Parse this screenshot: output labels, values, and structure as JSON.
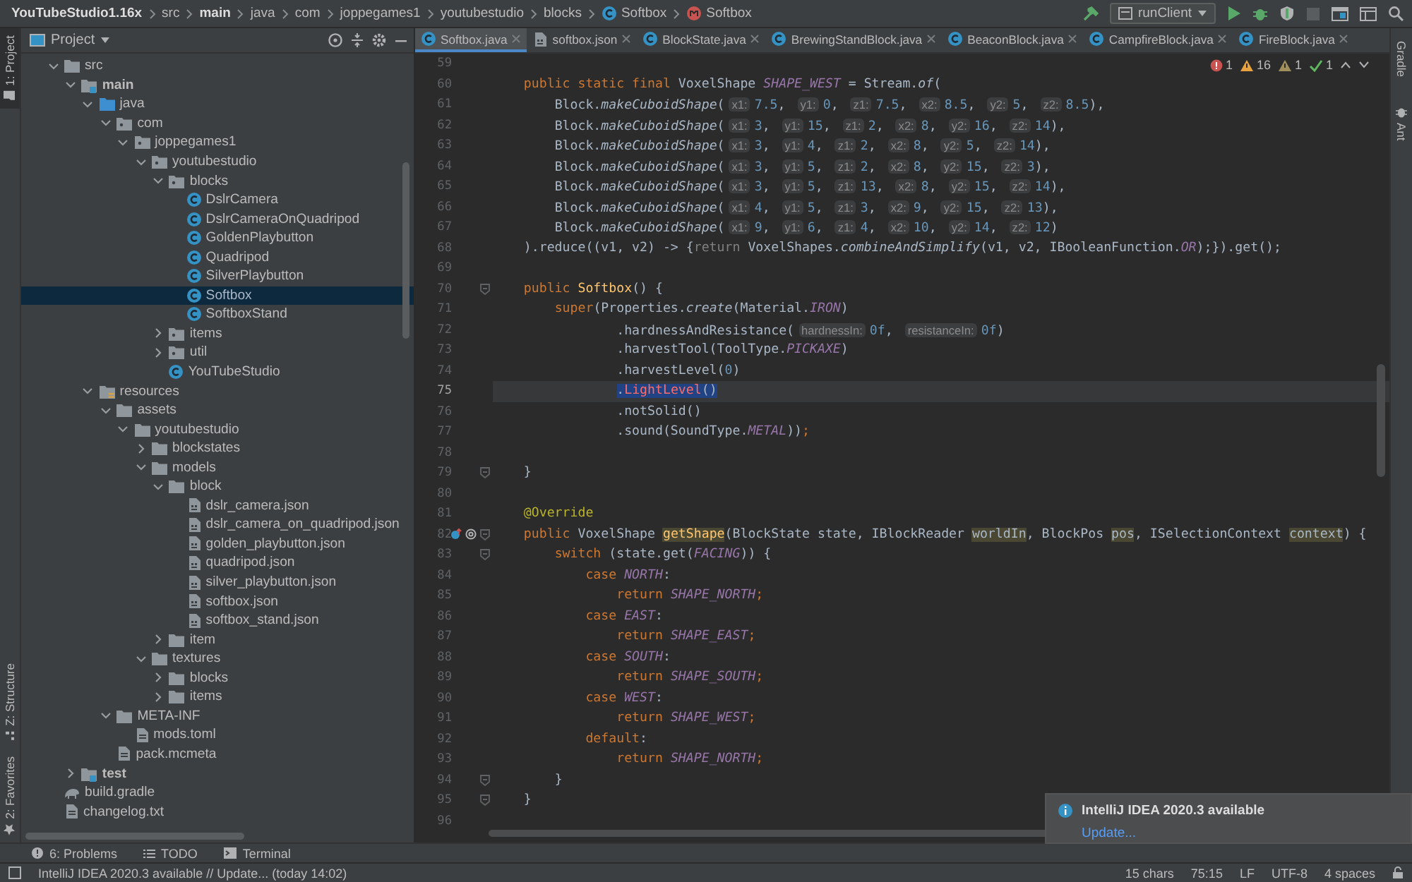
{
  "breadcrumbs": [
    {
      "label": "YouTubeStudio1.16x",
      "kind": "project"
    },
    {
      "label": "src",
      "kind": "folder"
    },
    {
      "label": "main",
      "kind": "module"
    },
    {
      "label": "java",
      "kind": "folder"
    },
    {
      "label": "com",
      "kind": "folder"
    },
    {
      "label": "joppegames1",
      "kind": "folder"
    },
    {
      "label": "youtubestudio",
      "kind": "folder"
    },
    {
      "label": "blocks",
      "kind": "folder"
    },
    {
      "label": "Softbox",
      "kind": "class"
    },
    {
      "label": "Softbox",
      "kind": "method"
    }
  ],
  "toolbar": {
    "run_config": "runClient"
  },
  "left_stripe": [
    {
      "label": "1: Project",
      "kind": "project",
      "selected": true
    },
    {
      "label": "Z: Structure",
      "kind": "structure",
      "selected": false
    },
    {
      "label": "2: Favorites",
      "kind": "favorites",
      "selected": false
    }
  ],
  "right_stripe": [
    {
      "label": "Gradle",
      "kind": "gradle"
    },
    {
      "label": "Ant",
      "kind": "ant"
    }
  ],
  "tool_window": {
    "title": "Project"
  },
  "tree": [
    {
      "label": "src",
      "kind": "folder",
      "expanded": true,
      "selected": false,
      "children": [
        {
          "label": "main",
          "kind": "module",
          "expanded": true,
          "selected": false,
          "children": [
            {
              "label": "java",
              "kind": "source",
              "expanded": true,
              "selected": false,
              "children": [
                {
                  "label": "com",
                  "kind": "package",
                  "expanded": true,
                  "selected": false,
                  "children": [
                    {
                      "label": "joppegames1",
                      "kind": "package",
                      "expanded": true,
                      "selected": false,
                      "children": [
                        {
                          "label": "youtubestudio",
                          "kind": "package",
                          "expanded": true,
                          "selected": false,
                          "children": [
                            {
                              "label": "blocks",
                              "kind": "package",
                              "expanded": true,
                              "selected": false,
                              "children": [
                                {
                                  "label": "DslrCamera",
                                  "kind": "class",
                                  "selected": false
                                },
                                {
                                  "label": "DslrCameraOnQuadripod",
                                  "kind": "class",
                                  "selected": false
                                },
                                {
                                  "label": "GoldenPlaybutton",
                                  "kind": "class",
                                  "selected": false
                                },
                                {
                                  "label": "Quadripod",
                                  "kind": "class",
                                  "selected": false
                                },
                                {
                                  "label": "SilverPlaybutton",
                                  "kind": "class",
                                  "selected": false
                                },
                                {
                                  "label": "Softbox",
                                  "kind": "class",
                                  "selected": true
                                },
                                {
                                  "label": "SoftboxStand",
                                  "kind": "class",
                                  "selected": false
                                }
                              ]
                            },
                            {
                              "label": "items",
                              "kind": "package",
                              "expanded": false,
                              "selected": false
                            },
                            {
                              "label": "util",
                              "kind": "package",
                              "expanded": false,
                              "selected": false
                            },
                            {
                              "label": "YouTubeStudio",
                              "kind": "class",
                              "selected": false
                            }
                          ]
                        }
                      ]
                    }
                  ]
                }
              ]
            },
            {
              "label": "resources",
              "kind": "resources",
              "expanded": true,
              "selected": false,
              "children": [
                {
                  "label": "assets",
                  "kind": "folder",
                  "expanded": true,
                  "selected": false,
                  "children": [
                    {
                      "label": "youtubestudio",
                      "kind": "folder",
                      "expanded": true,
                      "selected": false,
                      "children": [
                        {
                          "label": "blockstates",
                          "kind": "folder",
                          "expanded": false,
                          "selected": false
                        },
                        {
                          "label": "models",
                          "kind": "folder",
                          "expanded": true,
                          "selected": false,
                          "children": [
                            {
                              "label": "block",
                              "kind": "folder",
                              "expanded": true,
                              "selected": false,
                              "children": [
                                {
                                  "label": "dslr_camera.json",
                                  "kind": "json",
                                  "selected": false
                                },
                                {
                                  "label": "dslr_camera_on_quadripod.json",
                                  "kind": "json",
                                  "selected": false
                                },
                                {
                                  "label": "golden_playbutton.json",
                                  "kind": "json",
                                  "selected": false
                                },
                                {
                                  "label": "quadripod.json",
                                  "kind": "json",
                                  "selected": false
                                },
                                {
                                  "label": "silver_playbutton.json",
                                  "kind": "json",
                                  "selected": false
                                },
                                {
                                  "label": "softbox.json",
                                  "kind": "json",
                                  "selected": false
                                },
                                {
                                  "label": "softbox_stand.json",
                                  "kind": "json",
                                  "selected": false
                                }
                              ]
                            },
                            {
                              "label": "item",
                              "kind": "folder",
                              "expanded": false,
                              "selected": false
                            }
                          ]
                        },
                        {
                          "label": "textures",
                          "kind": "folder",
                          "expanded": true,
                          "selected": false,
                          "children": [
                            {
                              "label": "blocks",
                              "kind": "folder",
                              "expanded": false,
                              "selected": false
                            },
                            {
                              "label": "items",
                              "kind": "folder",
                              "expanded": false,
                              "selected": false
                            }
                          ]
                        }
                      ]
                    }
                  ]
                },
                {
                  "label": "META-INF",
                  "kind": "folder",
                  "expanded": true,
                  "selected": false,
                  "children": [
                    {
                      "label": "mods.toml",
                      "kind": "file",
                      "selected": false
                    }
                  ]
                },
                {
                  "label": "pack.mcmeta",
                  "kind": "file",
                  "selected": false
                }
              ]
            }
          ]
        },
        {
          "label": "test",
          "kind": "module",
          "expanded": false,
          "selected": false
        }
      ]
    },
    {
      "label": "build.gradle",
      "kind": "gradle",
      "selected": false
    },
    {
      "label": "changelog.txt",
      "kind": "file",
      "selected": false
    }
  ],
  "tabs": [
    {
      "label": "Softbox.java",
      "kind": "class",
      "selected": true
    },
    {
      "label": "softbox.json",
      "kind": "json",
      "selected": false
    },
    {
      "label": "BlockState.java",
      "kind": "class",
      "selected": false
    },
    {
      "label": "BrewingStandBlock.java",
      "kind": "class",
      "selected": false
    },
    {
      "label": "BeaconBlock.java",
      "kind": "class",
      "selected": false
    },
    {
      "label": "CampfireBlock.java",
      "kind": "class",
      "selected": false
    },
    {
      "label": "FireBlock.java",
      "kind": "class",
      "selected": false
    }
  ],
  "inspections": [
    {
      "kind": "error",
      "count": "1"
    },
    {
      "kind": "warning",
      "count": "16"
    },
    {
      "kind": "weak",
      "count": "1"
    },
    {
      "kind": "typo",
      "count": "1"
    }
  ],
  "code": [
    {
      "n": "59"
    },
    {
      "n": "60",
      "tokens": [
        {
          "kind": "kw",
          "text": "    public static final "
        },
        {
          "kind": "p",
          "text": "VoxelShape "
        },
        {
          "kind": "const",
          "text": "SHAPE_WEST"
        },
        {
          "kind": "p",
          "text": " = Stream."
        },
        {
          "kind": "fn",
          "text": "of"
        },
        {
          "kind": "p",
          "text": "("
        }
      ]
    },
    {
      "n": "61",
      "tokens": [
        {
          "kind": "p",
          "text": "        Block."
        },
        {
          "kind": "fn",
          "text": "makeCuboidShape"
        },
        {
          "kind": "p",
          "text": "("
        },
        {
          "kind": "hint",
          "text": "x1:"
        },
        {
          "kind": "num",
          "text": "7.5"
        },
        {
          "kind": "p",
          "text": ", "
        },
        {
          "kind": "hint",
          "text": "y1:"
        },
        {
          "kind": "num",
          "text": "0"
        },
        {
          "kind": "p",
          "text": ", "
        },
        {
          "kind": "hint",
          "text": "z1:"
        },
        {
          "kind": "num",
          "text": "7.5"
        },
        {
          "kind": "p",
          "text": ", "
        },
        {
          "kind": "hint",
          "text": "x2:"
        },
        {
          "kind": "num",
          "text": "8.5"
        },
        {
          "kind": "p",
          "text": ", "
        },
        {
          "kind": "hint",
          "text": "y2:"
        },
        {
          "kind": "num",
          "text": "5"
        },
        {
          "kind": "p",
          "text": ", "
        },
        {
          "kind": "hint",
          "text": "z2:"
        },
        {
          "kind": "num",
          "text": "8.5"
        },
        {
          "kind": "p",
          "text": "),"
        }
      ]
    },
    {
      "n": "62",
      "tokens": [
        {
          "kind": "p",
          "text": "        Block."
        },
        {
          "kind": "fn",
          "text": "makeCuboidShape"
        },
        {
          "kind": "p",
          "text": "("
        },
        {
          "kind": "hint",
          "text": "x1:"
        },
        {
          "kind": "num",
          "text": "3"
        },
        {
          "kind": "p",
          "text": ", "
        },
        {
          "kind": "hint",
          "text": "y1:"
        },
        {
          "kind": "num",
          "text": "15"
        },
        {
          "kind": "p",
          "text": ", "
        },
        {
          "kind": "hint",
          "text": "z1:"
        },
        {
          "kind": "num",
          "text": "2"
        },
        {
          "kind": "p",
          "text": ", "
        },
        {
          "kind": "hint",
          "text": "x2:"
        },
        {
          "kind": "num",
          "text": "8"
        },
        {
          "kind": "p",
          "text": ", "
        },
        {
          "kind": "hint",
          "text": "y2:"
        },
        {
          "kind": "num",
          "text": "16"
        },
        {
          "kind": "p",
          "text": ", "
        },
        {
          "kind": "hint",
          "text": "z2:"
        },
        {
          "kind": "num",
          "text": "14"
        },
        {
          "kind": "p",
          "text": "),"
        }
      ]
    },
    {
      "n": "63",
      "tokens": [
        {
          "kind": "p",
          "text": "        Block."
        },
        {
          "kind": "fn",
          "text": "makeCuboidShape"
        },
        {
          "kind": "p",
          "text": "("
        },
        {
          "kind": "hint",
          "text": "x1:"
        },
        {
          "kind": "num",
          "text": "3"
        },
        {
          "kind": "p",
          "text": ", "
        },
        {
          "kind": "hint",
          "text": "y1:"
        },
        {
          "kind": "num",
          "text": "4"
        },
        {
          "kind": "p",
          "text": ", "
        },
        {
          "kind": "hint",
          "text": "z1:"
        },
        {
          "kind": "num",
          "text": "2"
        },
        {
          "kind": "p",
          "text": ", "
        },
        {
          "kind": "hint",
          "text": "x2:"
        },
        {
          "kind": "num",
          "text": "8"
        },
        {
          "kind": "p",
          "text": ", "
        },
        {
          "kind": "hint",
          "text": "y2:"
        },
        {
          "kind": "num",
          "text": "5"
        },
        {
          "kind": "p",
          "text": ", "
        },
        {
          "kind": "hint",
          "text": "z2:"
        },
        {
          "kind": "num",
          "text": "14"
        },
        {
          "kind": "p",
          "text": "),"
        }
      ]
    },
    {
      "n": "64",
      "tokens": [
        {
          "kind": "p",
          "text": "        Block."
        },
        {
          "kind": "fn",
          "text": "makeCuboidShape"
        },
        {
          "kind": "p",
          "text": "("
        },
        {
          "kind": "hint",
          "text": "x1:"
        },
        {
          "kind": "num",
          "text": "3"
        },
        {
          "kind": "p",
          "text": ", "
        },
        {
          "kind": "hint",
          "text": "y1:"
        },
        {
          "kind": "num",
          "text": "5"
        },
        {
          "kind": "p",
          "text": ", "
        },
        {
          "kind": "hint",
          "text": "z1:"
        },
        {
          "kind": "num",
          "text": "2"
        },
        {
          "kind": "p",
          "text": ", "
        },
        {
          "kind": "hint",
          "text": "x2:"
        },
        {
          "kind": "num",
          "text": "8"
        },
        {
          "kind": "p",
          "text": ", "
        },
        {
          "kind": "hint",
          "text": "y2:"
        },
        {
          "kind": "num",
          "text": "15"
        },
        {
          "kind": "p",
          "text": ", "
        },
        {
          "kind": "hint",
          "text": "z2:"
        },
        {
          "kind": "num",
          "text": "3"
        },
        {
          "kind": "p",
          "text": "),"
        }
      ]
    },
    {
      "n": "65",
      "tokens": [
        {
          "kind": "p",
          "text": "        Block."
        },
        {
          "kind": "fn",
          "text": "makeCuboidShape"
        },
        {
          "kind": "p",
          "text": "("
        },
        {
          "kind": "hint",
          "text": "x1:"
        },
        {
          "kind": "num",
          "text": "3"
        },
        {
          "kind": "p",
          "text": ", "
        },
        {
          "kind": "hint",
          "text": "y1:"
        },
        {
          "kind": "num",
          "text": "5"
        },
        {
          "kind": "p",
          "text": ", "
        },
        {
          "kind": "hint",
          "text": "z1:"
        },
        {
          "kind": "num",
          "text": "13"
        },
        {
          "kind": "p",
          "text": ", "
        },
        {
          "kind": "hint",
          "text": "x2:"
        },
        {
          "kind": "num",
          "text": "8"
        },
        {
          "kind": "p",
          "text": ", "
        },
        {
          "kind": "hint",
          "text": "y2:"
        },
        {
          "kind": "num",
          "text": "15"
        },
        {
          "kind": "p",
          "text": ", "
        },
        {
          "kind": "hint",
          "text": "z2:"
        },
        {
          "kind": "num",
          "text": "14"
        },
        {
          "kind": "p",
          "text": "),"
        }
      ]
    },
    {
      "n": "66",
      "tokens": [
        {
          "kind": "p",
          "text": "        Block."
        },
        {
          "kind": "fn",
          "text": "makeCuboidShape"
        },
        {
          "kind": "p",
          "text": "("
        },
        {
          "kind": "hint",
          "text": "x1:"
        },
        {
          "kind": "num",
          "text": "4"
        },
        {
          "kind": "p",
          "text": ", "
        },
        {
          "kind": "hint",
          "text": "y1:"
        },
        {
          "kind": "num",
          "text": "5"
        },
        {
          "kind": "p",
          "text": ", "
        },
        {
          "kind": "hint",
          "text": "z1:"
        },
        {
          "kind": "num",
          "text": "3"
        },
        {
          "kind": "p",
          "text": ", "
        },
        {
          "kind": "hint",
          "text": "x2:"
        },
        {
          "kind": "num",
          "text": "9"
        },
        {
          "kind": "p",
          "text": ", "
        },
        {
          "kind": "hint",
          "text": "y2:"
        },
        {
          "kind": "num",
          "text": "15"
        },
        {
          "kind": "p",
          "text": ", "
        },
        {
          "kind": "hint",
          "text": "z2:"
        },
        {
          "kind": "num",
          "text": "13"
        },
        {
          "kind": "p",
          "text": "),"
        }
      ]
    },
    {
      "n": "67",
      "tokens": [
        {
          "kind": "p",
          "text": "        Block."
        },
        {
          "kind": "fn",
          "text": "makeCuboidShape"
        },
        {
          "kind": "p",
          "text": "("
        },
        {
          "kind": "hint",
          "text": "x1:"
        },
        {
          "kind": "num",
          "text": "9"
        },
        {
          "kind": "p",
          "text": ", "
        },
        {
          "kind": "hint",
          "text": "y1:"
        },
        {
          "kind": "num",
          "text": "6"
        },
        {
          "kind": "p",
          "text": ", "
        },
        {
          "kind": "hint",
          "text": "z1:"
        },
        {
          "kind": "num",
          "text": "4"
        },
        {
          "kind": "p",
          "text": ", "
        },
        {
          "kind": "hint",
          "text": "x2:"
        },
        {
          "kind": "num",
          "text": "10"
        },
        {
          "kind": "p",
          "text": ", "
        },
        {
          "kind": "hint",
          "text": "y2:"
        },
        {
          "kind": "num",
          "text": "14"
        },
        {
          "kind": "p",
          "text": ", "
        },
        {
          "kind": "hint",
          "text": "z2:"
        },
        {
          "kind": "num",
          "text": "12"
        },
        {
          "kind": "p",
          "text": ")"
        }
      ]
    },
    {
      "n": "68",
      "tokens": [
        {
          "kind": "p",
          "text": "    ).reduce((v1, v2) -> {"
        },
        {
          "kind": "dim",
          "text": "return"
        },
        {
          "kind": "p",
          "text": " VoxelShapes."
        },
        {
          "kind": "fn",
          "text": "combineAndSimplify"
        },
        {
          "kind": "p",
          "text": "(v1, v2, IBooleanFunction."
        },
        {
          "kind": "const",
          "text": "OR"
        },
        {
          "kind": "p",
          "text": ");}).get();"
        }
      ]
    },
    {
      "n": "69"
    },
    {
      "n": "70",
      "fold": true,
      "tokens": [
        {
          "kind": "kw",
          "text": "    public "
        },
        {
          "kind": "decl",
          "text": "Softbox"
        },
        {
          "kind": "p",
          "text": "() {"
        }
      ]
    },
    {
      "n": "71",
      "tokens": [
        {
          "kind": "kw",
          "text": "        super"
        },
        {
          "kind": "p",
          "text": "(Properties."
        },
        {
          "kind": "fn",
          "text": "create"
        },
        {
          "kind": "p",
          "text": "(Material."
        },
        {
          "kind": "const",
          "text": "IRON"
        },
        {
          "kind": "p",
          "text": ")"
        }
      ]
    },
    {
      "n": "72",
      "tokens": [
        {
          "kind": "p",
          "text": "                .hardnessAndResistance("
        },
        {
          "kind": "hint",
          "text": "hardnessIn:"
        },
        {
          "kind": "num",
          "text": "0f"
        },
        {
          "kind": "p",
          "text": ", "
        },
        {
          "kind": "hint",
          "text": "resistanceIn:"
        },
        {
          "kind": "num",
          "text": "0f"
        },
        {
          "kind": "p",
          "text": ")"
        }
      ]
    },
    {
      "n": "73",
      "tokens": [
        {
          "kind": "p",
          "text": "                .harvestTool(ToolType."
        },
        {
          "kind": "const",
          "text": "PICKAXE"
        },
        {
          "kind": "p",
          "text": ")"
        }
      ]
    },
    {
      "n": "74",
      "tokens": [
        {
          "kind": "p",
          "text": "                .harvestLevel("
        },
        {
          "kind": "num",
          "text": "0"
        },
        {
          "kind": "p",
          "text": ")"
        }
      ]
    },
    {
      "n": "75",
      "current": true,
      "tokens": [
        {
          "kind": "sel",
          "text": "                ."
        },
        {
          "kind": "selerr",
          "text": "LightLevel"
        },
        {
          "kind": "sel",
          "text": "()"
        }
      ]
    },
    {
      "n": "76",
      "tokens": [
        {
          "kind": "p",
          "text": "                .notSolid()"
        }
      ]
    },
    {
      "n": "77",
      "tokens": [
        {
          "kind": "p",
          "text": "                .sound(SoundType."
        },
        {
          "kind": "const",
          "text": "METAL"
        },
        {
          "kind": "p",
          "text": "))"
        },
        {
          "kind": "kw",
          "text": ";"
        }
      ]
    },
    {
      "n": "78"
    },
    {
      "n": "79",
      "fold": true,
      "tokens": [
        {
          "kind": "p",
          "text": "    }"
        }
      ]
    },
    {
      "n": "80"
    },
    {
      "n": "81",
      "tokens": [
        {
          "kind": "ann",
          "text": "    @Override"
        }
      ]
    },
    {
      "n": "82",
      "fold": true,
      "override": true,
      "tokens": [
        {
          "kind": "kw",
          "text": "    public "
        },
        {
          "kind": "p",
          "text": "VoxelShape "
        },
        {
          "kind": "warndecl",
          "text": "getShape"
        },
        {
          "kind": "p",
          "text": "(BlockState state, IBlockReader "
        },
        {
          "kind": "warn",
          "text": "worldIn"
        },
        {
          "kind": "p",
          "text": ", BlockPos "
        },
        {
          "kind": "warn",
          "text": "pos"
        },
        {
          "kind": "p",
          "text": ", ISelectionContext "
        },
        {
          "kind": "warn",
          "text": "context"
        },
        {
          "kind": "p",
          "text": ") {"
        }
      ]
    },
    {
      "n": "83",
      "fold": true,
      "tokens": [
        {
          "kind": "kw",
          "text": "        switch "
        },
        {
          "kind": "p",
          "text": "(state.get("
        },
        {
          "kind": "const",
          "text": "FACING"
        },
        {
          "kind": "p",
          "text": ")) {"
        }
      ]
    },
    {
      "n": "84",
      "tokens": [
        {
          "kind": "kw",
          "text": "            case "
        },
        {
          "kind": "const",
          "text": "NORTH"
        },
        {
          "kind": "p",
          "text": ":"
        }
      ]
    },
    {
      "n": "85",
      "tokens": [
        {
          "kind": "kw",
          "text": "                return "
        },
        {
          "kind": "const",
          "text": "SHAPE_NORTH"
        },
        {
          "kind": "kw",
          "text": ";"
        }
      ]
    },
    {
      "n": "86",
      "tokens": [
        {
          "kind": "kw",
          "text": "            case "
        },
        {
          "kind": "const",
          "text": "EAST"
        },
        {
          "kind": "p",
          "text": ":"
        }
      ]
    },
    {
      "n": "87",
      "tokens": [
        {
          "kind": "kw",
          "text": "                return "
        },
        {
          "kind": "const",
          "text": "SHAPE_EAST"
        },
        {
          "kind": "kw",
          "text": ";"
        }
      ]
    },
    {
      "n": "88",
      "tokens": [
        {
          "kind": "kw",
          "text": "            case "
        },
        {
          "kind": "const",
          "text": "SOUTH"
        },
        {
          "kind": "p",
          "text": ":"
        }
      ]
    },
    {
      "n": "89",
      "tokens": [
        {
          "kind": "kw",
          "text": "                return "
        },
        {
          "kind": "const",
          "text": "SHAPE_SOUTH"
        },
        {
          "kind": "kw",
          "text": ";"
        }
      ]
    },
    {
      "n": "90",
      "tokens": [
        {
          "kind": "kw",
          "text": "            case "
        },
        {
          "kind": "const",
          "text": "WEST"
        },
        {
          "kind": "p",
          "text": ":"
        }
      ]
    },
    {
      "n": "91",
      "tokens": [
        {
          "kind": "kw",
          "text": "                return "
        },
        {
          "kind": "const",
          "text": "SHAPE_WEST"
        },
        {
          "kind": "kw",
          "text": ";"
        }
      ]
    },
    {
      "n": "92",
      "tokens": [
        {
          "kind": "kw",
          "text": "            default"
        },
        {
          "kind": "p",
          "text": ":"
        }
      ]
    },
    {
      "n": "93",
      "tokens": [
        {
          "kind": "kw",
          "text": "                return "
        },
        {
          "kind": "const",
          "text": "SHAPE_NORTH"
        },
        {
          "kind": "kw",
          "text": ";"
        }
      ]
    },
    {
      "n": "94",
      "fold": true,
      "tokens": [
        {
          "kind": "p",
          "text": "        }"
        }
      ]
    },
    {
      "n": "95",
      "fold": true,
      "tokens": [
        {
          "kind": "p",
          "text": "    }"
        }
      ]
    },
    {
      "n": "96"
    }
  ],
  "bottom_tools": [
    {
      "label": "6: Problems",
      "kind": "problems"
    },
    {
      "label": "TODO",
      "kind": "todo"
    },
    {
      "label": "Terminal",
      "kind": "terminal"
    }
  ],
  "notification": {
    "title": "IntelliJ IDEA 2020.3 available",
    "link": "Update..."
  },
  "status_bar": {
    "message": "IntelliJ IDEA 2020.3 available // Update... (today 14:02)",
    "items": [
      "15 chars",
      "75:15",
      "LF",
      "UTF-8",
      "4 spaces"
    ]
  }
}
